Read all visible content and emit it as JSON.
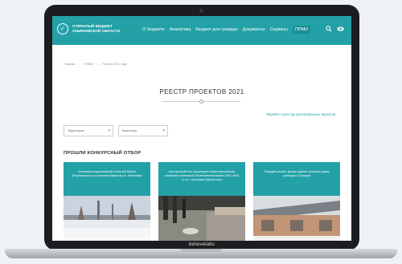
{
  "device": {
    "brand": "believelabs"
  },
  "header": {
    "logo_text": "ОТКРЫТЫЙ БЮДЖЕТ УЛЬЯНОВСКОЙ ОБЛАСТИ",
    "logo_icon": "checkmark-icon",
    "menu": [
      {
        "label": "О бюджете"
      },
      {
        "label": "Аналитика"
      },
      {
        "label": "Бюджет для граждан"
      },
      {
        "label": "Документы"
      },
      {
        "label": "Сервисы"
      },
      {
        "label": "ППМИ",
        "active": true
      }
    ],
    "icons": [
      "search-icon",
      "accessibility-icon"
    ]
  },
  "breadcrumb": [
    "Главная",
    "ППМИ",
    "Реестр 2021 года"
  ],
  "page": {
    "title": "РЕЕСТР ПРОЕКТОВ 2021",
    "registry_link": "Перейти к реестру реализованных проектов"
  },
  "filters": {
    "territory": "Территория",
    "category": "Категория"
  },
  "section": {
    "title": "ПРОШЛИ КОНКУРСНЫЙ ОТБОР"
  },
  "cards": [
    {
      "title": "Установка водонапорной стальной башни (Рожновского) со стальным баком в р.п. Игнатовка"
    },
    {
      "title": "Благоустройство территории памятника воинам погибшим в Великой Отечественной войне 1941-1945 г.г. в с. Ореховая Бурпинского"
    },
    {
      "title": "Текущий ремонт крыши здания сельского дома культуры с Сухорой"
    }
  ],
  "colors": {
    "accent": "#23a1a7",
    "accent_dark": "#1a8e93",
    "text_dark": "#2b2f35",
    "frame": "#1c1d20"
  }
}
